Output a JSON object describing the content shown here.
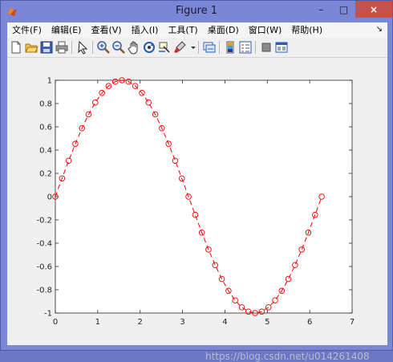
{
  "window": {
    "title": "Figure 1",
    "close_label": "×",
    "min_label": "–",
    "max_label": "□"
  },
  "menu": {
    "items": [
      "文件(F)",
      "编辑(E)",
      "查看(V)",
      "插入(I)",
      "工具(T)",
      "桌面(D)",
      "窗口(W)",
      "帮助(H)"
    ],
    "overflow": "↘"
  },
  "toolbar": {
    "icons": [
      "new-figure-icon",
      "open-file-icon",
      "save-figure-icon",
      "print-figure-icon",
      "edit-plot-icon",
      "zoom-in-icon",
      "zoom-out-icon",
      "pan-icon",
      "rotate-3d-icon",
      "data-cursor-icon",
      "brush-icon",
      "link-plot-icon",
      "insert-colorbar-icon",
      "insert-legend-icon",
      "hide-plot-tools-icon",
      "show-plot-tools-icon"
    ]
  },
  "watermark": "https://blog.csdn.net/u014261408",
  "chart_data": {
    "type": "line",
    "title": "",
    "xlabel": "",
    "ylabel": "",
    "xlim": [
      0,
      7
    ],
    "ylim": [
      -1,
      1
    ],
    "xticks": [
      "0",
      "1",
      "2",
      "3",
      "4",
      "5",
      "6",
      "7"
    ],
    "yticks": [
      "-1",
      "-0.8",
      "-0.6",
      "-0.4",
      "-0.2",
      "0",
      "0.2",
      "0.4",
      "0.6",
      "0.8",
      "1"
    ],
    "grid": false,
    "series": [
      {
        "line_style": "dashed",
        "marker": "circle",
        "color": "#ff0000",
        "x": [
          0,
          0.1571,
          0.3142,
          0.4712,
          0.6283,
          0.7854,
          0.9425,
          1.0996,
          1.2566,
          1.4137,
          1.5708,
          1.7279,
          1.885,
          2.042,
          2.1991,
          2.3562,
          2.5133,
          2.6704,
          2.8274,
          2.9845,
          3.1416,
          3.2987,
          3.4558,
          3.6128,
          3.7699,
          3.927,
          4.0841,
          4.2412,
          4.3982,
          4.5553,
          4.7124,
          4.8695,
          5.0265,
          5.1836,
          5.3407,
          5.4978,
          5.6549,
          5.8119,
          5.969,
          6.1261,
          6.2832
        ],
        "y": [
          0,
          0.1564,
          0.309,
          0.454,
          0.5878,
          0.7071,
          0.809,
          0.891,
          0.9511,
          0.9877,
          1.0,
          0.9877,
          0.9511,
          0.891,
          0.809,
          0.7071,
          0.5878,
          0.454,
          0.309,
          0.1564,
          0,
          -0.1564,
          -0.309,
          -0.454,
          -0.5878,
          -0.7071,
          -0.809,
          -0.891,
          -0.9511,
          -0.9877,
          -1.0,
          -0.9877,
          -0.9511,
          -0.891,
          -0.809,
          -0.7071,
          -0.5878,
          -0.454,
          -0.309,
          -0.1564,
          0
        ]
      }
    ]
  }
}
